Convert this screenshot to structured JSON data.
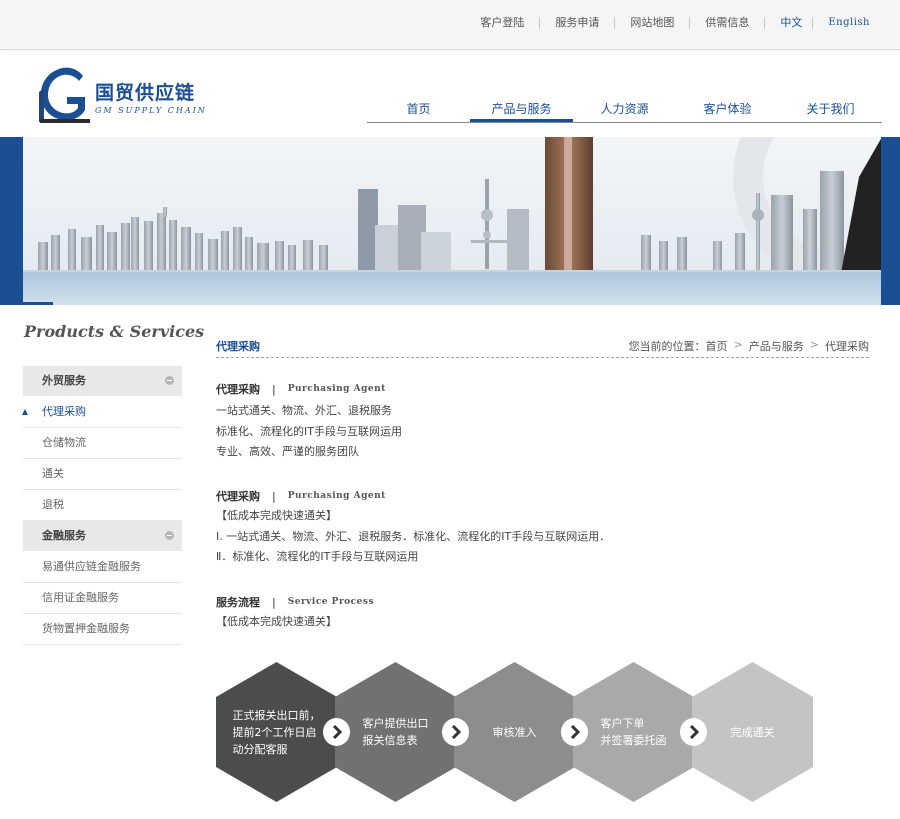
{
  "topbar": {
    "links": [
      "客户登陆",
      "服务申请",
      "网站地图",
      "供需信息"
    ],
    "lang_zh": "中文",
    "lang_en": "English"
  },
  "logo": {
    "name": "国贸供应链",
    "sub": "GM SUPPLY CHAIN"
  },
  "nav": {
    "items": [
      "首页",
      "产品与服务",
      "人力资源",
      "客户体验",
      "关于我们"
    ],
    "active": "产品与服务"
  },
  "sidebar": {
    "title": "Products & Services",
    "items": [
      {
        "label": "外贸服务",
        "type": "head"
      },
      {
        "label": "代理采购",
        "type": "active"
      },
      {
        "label": "仓储物流",
        "type": "item"
      },
      {
        "label": "通关",
        "type": "item"
      },
      {
        "label": "退税",
        "type": "item"
      },
      {
        "label": "金融服务",
        "type": "head"
      },
      {
        "label": "易通供应链金融服务",
        "type": "item"
      },
      {
        "label": "信用证金融服务",
        "type": "item"
      },
      {
        "label": "货物置押金融服务",
        "type": "item"
      }
    ]
  },
  "content": {
    "title": "代理采购",
    "breadcrumb": {
      "prefix": "您当前的位置：首页",
      "sep": ">",
      "mid": "产品与服务",
      "last": "代理采购"
    },
    "section1": {
      "title": "代理采购",
      "divider": "|",
      "en": "Purchasing Agent",
      "lines": [
        "一站式通关、物流、外汇、退税服务",
        "标准化、流程化的IT手段与互联网运用",
        "专业、高效、严谨的服务团队"
      ]
    },
    "section2": {
      "title": "代理采购",
      "divider": "|",
      "en": "Purchasing Agent",
      "lines": [
        "【低成本完成快速通关】",
        "Ⅰ. 一站式通关、物流、外汇、退税服务．标准化、流程化的IT手段与互联网运用．",
        "Ⅱ．标准化、流程化的IT手段与互联网运用"
      ]
    },
    "section3": {
      "title": "服务流程",
      "divider": "|",
      "en": "Service Process",
      "lines": [
        "【低成本完成快速通关】"
      ]
    }
  },
  "process": {
    "steps": [
      {
        "text": "正式报关出口前，\n提前2个工作日启\n动分配客服",
        "color": "#4a4d4c"
      },
      {
        "text": "客户提供出口\n报关信息表",
        "color": "#717171"
      },
      {
        "text": "审核准入",
        "color": "#8d8d8d"
      },
      {
        "text": "客户下单\n并签署委托函",
        "color": "#a9a9a9"
      },
      {
        "text": "完成通关",
        "color": "#c4c4c4"
      }
    ]
  },
  "colors": {
    "brand": "#1a4f94",
    "topbar": "#f5f5f5"
  }
}
